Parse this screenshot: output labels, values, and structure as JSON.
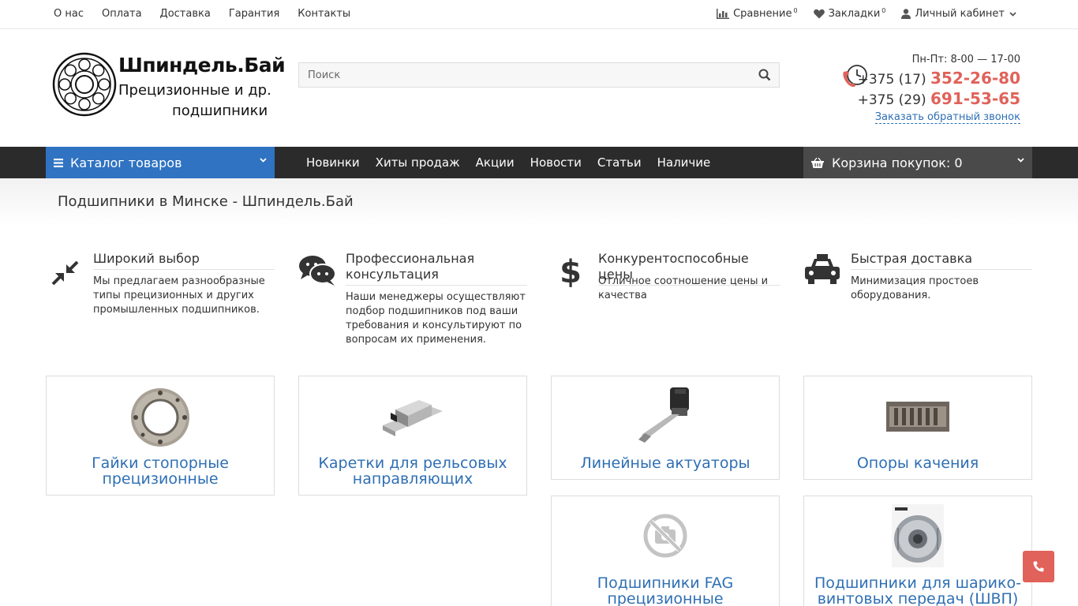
{
  "topnav": [
    "О нас",
    "Оплата",
    "Доставка",
    "Гарантия",
    "Контакты"
  ],
  "topright": {
    "compare_label": "Сравнение",
    "compare_count": "0",
    "bookmarks_label": "Закладки",
    "bookmarks_count": "0",
    "account_label": "Личный кабинет"
  },
  "logo": {
    "title": "Шпиндель.Бай",
    "sub1": "Прецизионные и др.",
    "sub2": "подшипники"
  },
  "search": {
    "placeholder": "Поиск"
  },
  "contacts": {
    "hours": "Пн-Пт: 8-00 — 17-00",
    "phone1_code": "+375 (17)",
    "phone1_number": "352-26-80",
    "phone2_code": "+375 (29)",
    "phone2_number": "691-53-65",
    "callback": "Заказать обратный звонок"
  },
  "navbar": {
    "catalog": "Каталог товаров",
    "items": [
      "Новинки",
      "Хиты продаж",
      "Акции",
      "Новости",
      "Статьи",
      "Наличие"
    ],
    "cart": "Корзина покупок: 0"
  },
  "page_title": "Подшипники в Минске - Шпиндель.Бай",
  "features": [
    {
      "icon": "compress-icon",
      "title": "Широкий выбор",
      "text": "Мы предлагаем разнообразные типы прецизионных и других промышленных подшипников."
    },
    {
      "icon": "chat-icon",
      "title": "Профессиональная консультация",
      "text": "Наши менеджеры осуществляют подбор подшипников под ваши требования и консультируют по вопросам их применения."
    },
    {
      "icon": "dollar-icon",
      "title": "Конкурентоспособные цены",
      "text": "Отличное соотношение цены и качества"
    },
    {
      "icon": "taxi-icon",
      "title": "Быстрая доставка",
      "text": "Минимизация простоев оборудования."
    }
  ],
  "categories": [
    {
      "title": "Гайки стопорные прецизионные",
      "image": "lock-nut-image"
    },
    {
      "title": "Каретки для рельсовых направляющих",
      "image": "rail-carriage-image"
    },
    {
      "title": "Линейные актуаторы",
      "image": "linear-actuator-image"
    },
    {
      "title": "Опоры качения",
      "image": "rolling-support-image"
    },
    {
      "title": "Подшипники FAG прецизионные",
      "image": "no-photo-icon"
    },
    {
      "title": "Подшипники для шарико-винтовых передач (ШВП)",
      "image": "ballscrew-bearing-image"
    }
  ],
  "colors": {
    "accent_blue": "#2f73c2",
    "nav_dark": "#2b2b2b",
    "phone_red": "#e0625a",
    "link_blue": "#2e6fb3"
  }
}
